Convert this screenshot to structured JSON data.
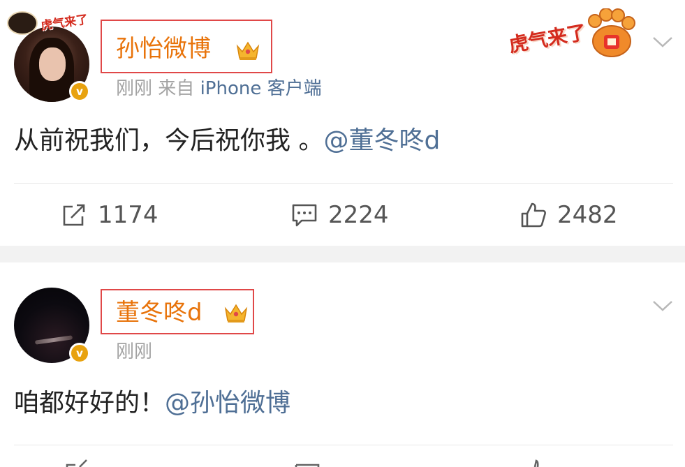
{
  "post1": {
    "sticker_text": "虎气来了",
    "name": "孙怡微博",
    "meta_time": "刚刚",
    "meta_from": "来自",
    "meta_source": "iPhone 客户端",
    "corner_sticker_text": "虎气来了",
    "content_text": "从前祝我们，今后祝你我 。",
    "content_mention": "@董冬咚d",
    "actions": {
      "repost_count": "1174",
      "comment_count": "2224",
      "like_count": "2482"
    },
    "badge_letter": "v"
  },
  "post2": {
    "name": "董冬咚d",
    "meta_time": "刚刚",
    "content_text": "咱都好好的！",
    "content_mention": "@孙怡微博",
    "badge_letter": "v"
  },
  "colors": {
    "name": "#e8730a",
    "link": "#4f6f95",
    "highlight_box": "#e04848",
    "verified_badge": "#e8a20f",
    "separator": "#f2f2f2"
  },
  "icons": {
    "repost": "repost-icon",
    "comment": "comment-icon",
    "like": "thumbs-up-icon",
    "crown": "crown-icon",
    "dropdown": "chevron-down-icon"
  }
}
